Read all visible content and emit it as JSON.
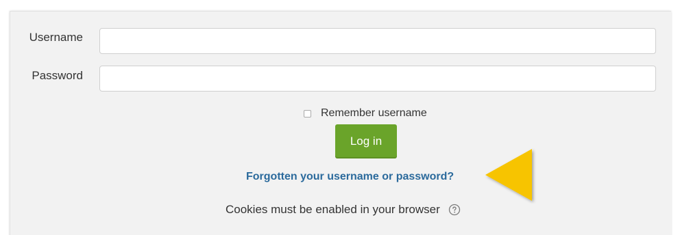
{
  "form": {
    "username_label": "Username",
    "username_value": "",
    "password_label": "Password",
    "password_value": "",
    "remember_label": "Remember username",
    "remember_checked": false,
    "login_button_label": "Log in",
    "forgot_link_text": "Forgotten your username or password?",
    "cookies_text": "Cookies must be enabled in your browser"
  },
  "colors": {
    "panel_background": "#f2f2f2",
    "login_button": "#6aa42a",
    "link": "#2b6a9c",
    "pointer_arrow": "#f7c400"
  },
  "icons": {
    "help": "question-circle-icon",
    "pointer": "yellow-triangle-pointer"
  }
}
